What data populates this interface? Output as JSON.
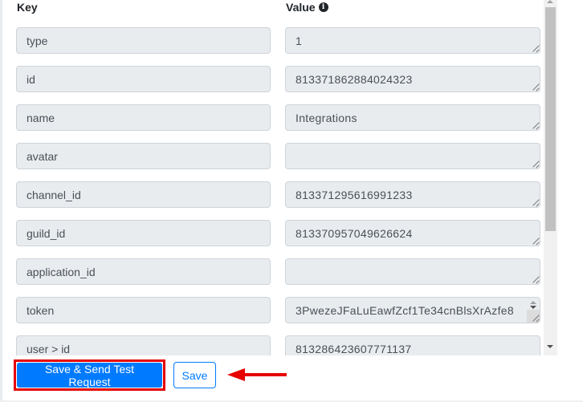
{
  "headers": {
    "key": "Key",
    "value": "Value",
    "value_icon": "info-circle-icon"
  },
  "rows": [
    {
      "key": "type",
      "value": "1"
    },
    {
      "key": "id",
      "value": "813371862884024323"
    },
    {
      "key": "name",
      "value": "Integrations"
    },
    {
      "key": "avatar",
      "value": ""
    },
    {
      "key": "channel_id",
      "value": "813371295616991233"
    },
    {
      "key": "guild_id",
      "value": "813370957049626624"
    },
    {
      "key": "application_id",
      "value": ""
    },
    {
      "key": "token",
      "value": "3PwezeJFaLuEawfZcf1Te34cnBlsXrAzfe8"
    },
    {
      "key": "user > id",
      "value": "813286423607771137"
    }
  ],
  "actions": {
    "save_send_label": "Save & Send Test Request",
    "save_label": "Save"
  },
  "annotation": {
    "highlight_color": "#e60000",
    "arrow_icon": "arrow-left-icon"
  },
  "colors": {
    "primary": "#007bff",
    "field_bg": "#e9ecef"
  }
}
